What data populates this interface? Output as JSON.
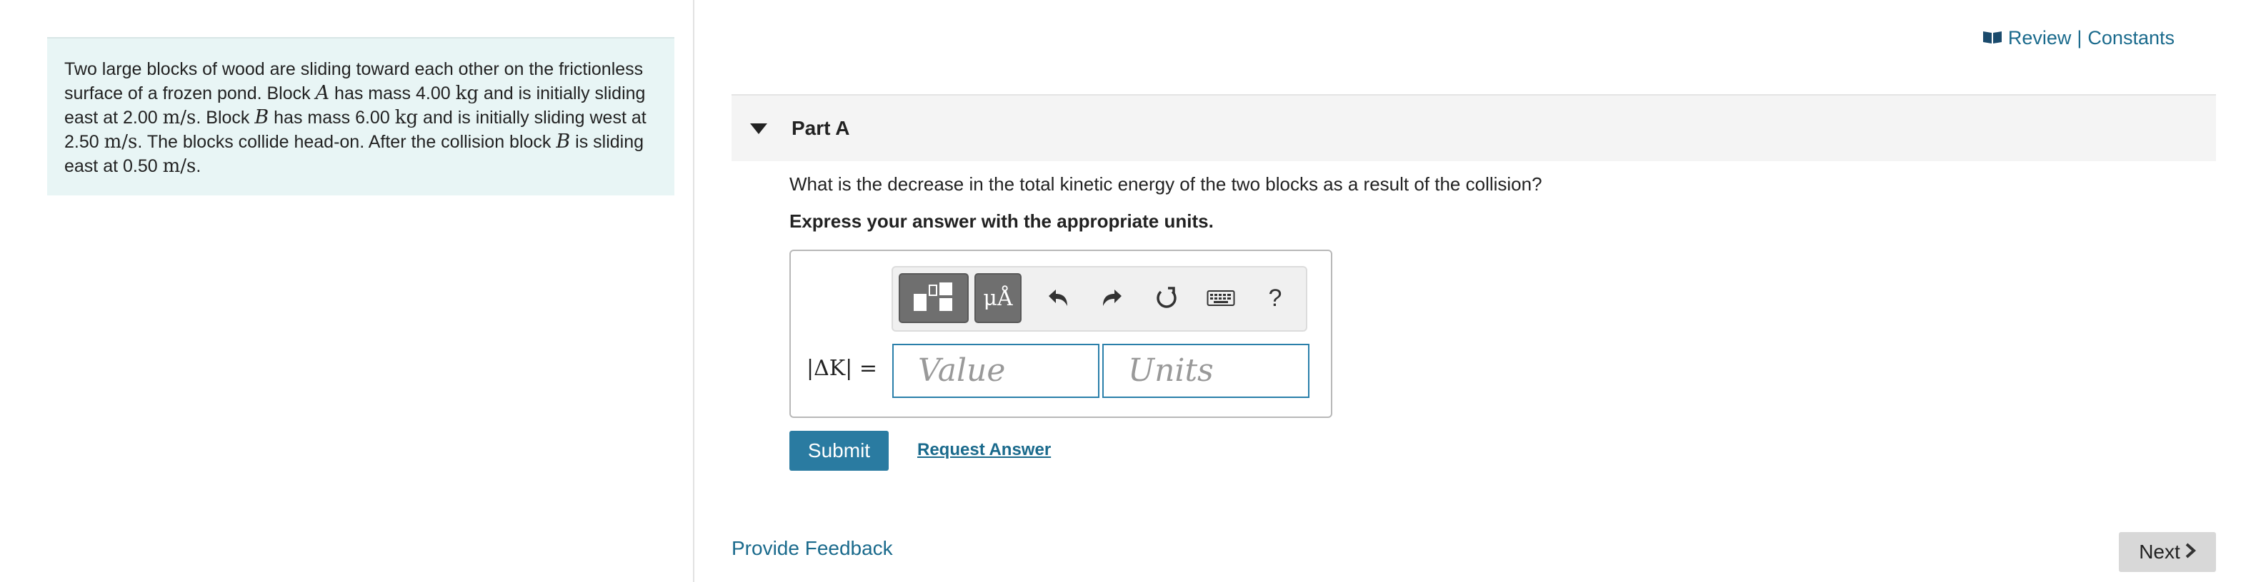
{
  "intro": {
    "s1": "Two large blocks of wood are sliding toward each other on the frictionless surface of a frozen pond. Block ",
    "blockA": "A",
    "s2": " has mass 4.00 ",
    "kg1": "kg",
    "s3": " and is initially sliding east at 2.00 ",
    "ms1": "m/s",
    "s4": ". Block ",
    "blockB": "B",
    "s5": " has mass 6.00 ",
    "kg2": "kg",
    "s6": " and is initially sliding west at 2.50 ",
    "ms2": "m/s",
    "s7": ". The blocks collide head-on. After the collision block ",
    "blockB2": "B",
    "s8": " is sliding east at 0.50 ",
    "ms3": "m/s",
    "s9": "."
  },
  "header": {
    "review_label": "Review",
    "separator": "|",
    "constants_label": "Constants"
  },
  "part": {
    "title": "Part A",
    "question": "What is the decrease in the total kinetic energy of the two blocks as a result of the collision?",
    "instruction": "Express your answer with the appropriate units."
  },
  "toolbar": {
    "units_label": "μÅ",
    "help_label": "?"
  },
  "answer": {
    "lhs": "|ΔK| =",
    "value_placeholder": "Value",
    "units_placeholder": "Units"
  },
  "actions": {
    "submit_label": "Submit",
    "request_label": "Request Answer"
  },
  "footer": {
    "feedback_label": "Provide Feedback",
    "next_label": "Next"
  },
  "colors": {
    "accent": "#2a7ba1",
    "link": "#1a6a8c",
    "intro_bg": "#e8f5f5"
  }
}
